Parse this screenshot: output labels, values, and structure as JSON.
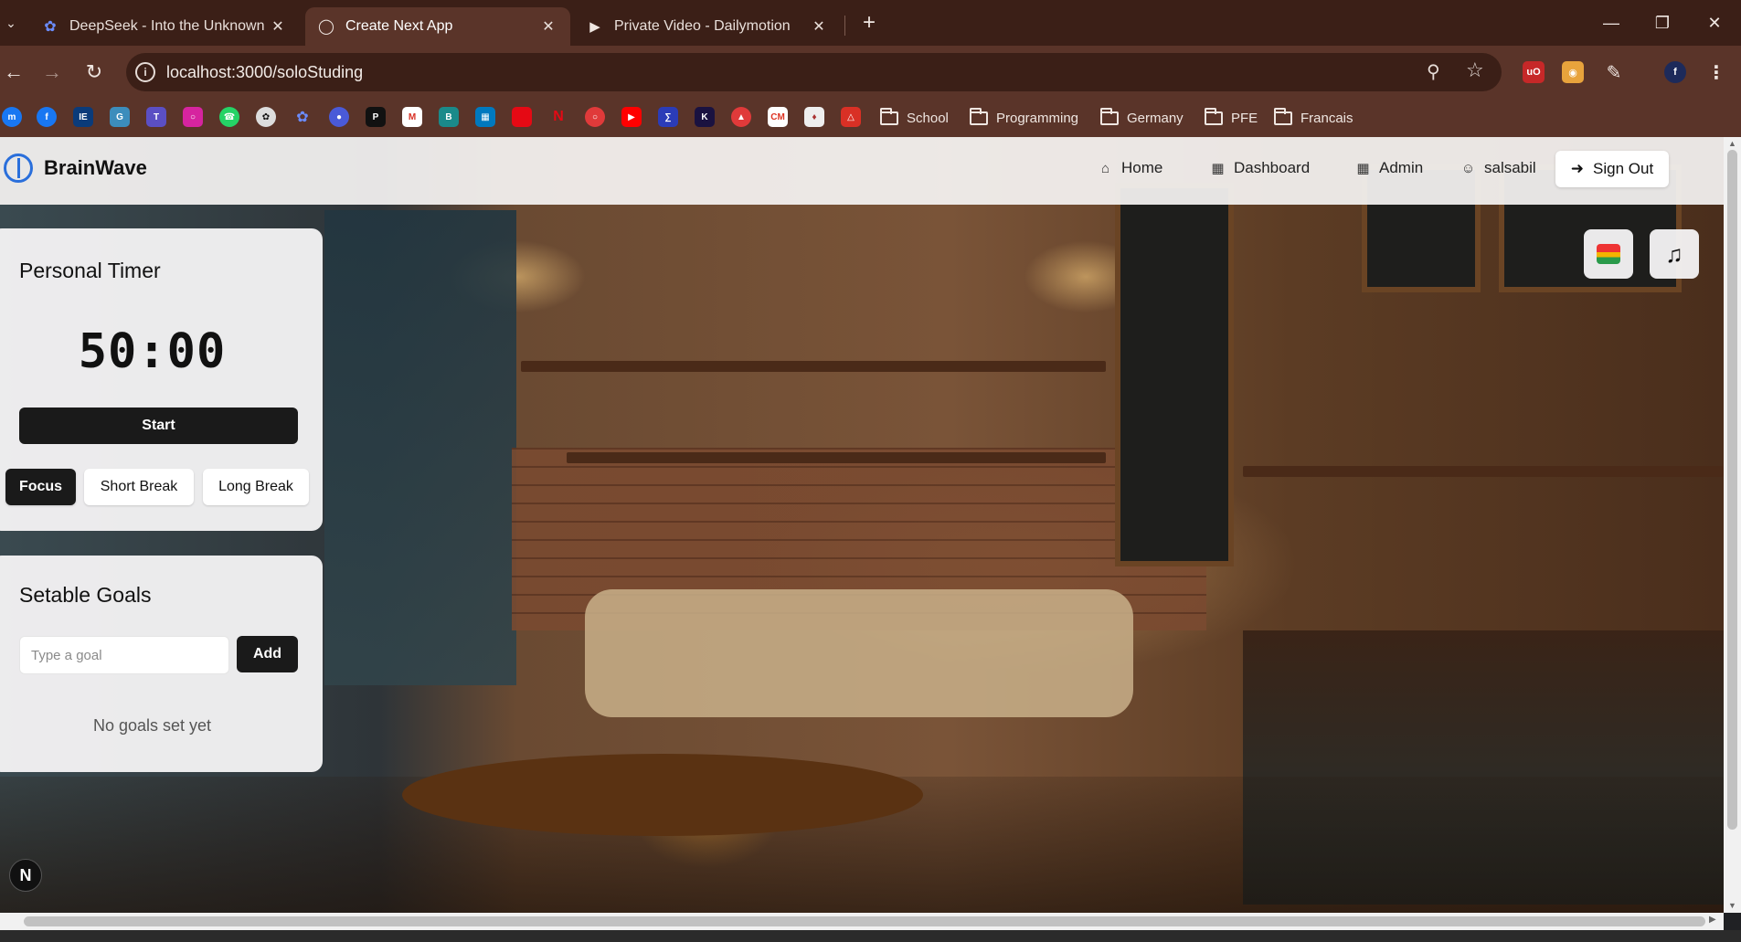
{
  "browser": {
    "tabs": [
      {
        "title": "DeepSeek - Into the Unknown",
        "icon": "deepseek-icon",
        "active": false
      },
      {
        "title": "Create Next App",
        "icon": "globe-icon",
        "active": true
      },
      {
        "title": "Private Video - Dailymotion",
        "icon": "dailymotion-icon",
        "active": false
      }
    ],
    "url": "localhost:3000/soloStuding",
    "bookmark_folders": [
      "School",
      "Programming",
      "Germany",
      "PFE",
      "Francais"
    ]
  },
  "app": {
    "brand": "BrainWave",
    "nav": {
      "home": "Home",
      "dashboard": "Dashboard",
      "admin": "Admin",
      "user": "salsabil",
      "sign_out": "Sign Out"
    },
    "timer": {
      "title": "Personal Timer",
      "display": "50:00",
      "start_label": "Start",
      "modes": [
        "Focus",
        "Short Break",
        "Long Break"
      ],
      "active_mode": "Focus"
    },
    "goals": {
      "title": "Setable Goals",
      "input_placeholder": "Type a goal",
      "add_label": "Add",
      "empty_message": "No goals set yet"
    },
    "next_badge": "N"
  },
  "colors": {
    "browser_frame": "#3b1f17",
    "toolbar": "#5a3429",
    "primary_button": "#1a1a1a",
    "brand_accent": "#2a6fdb"
  }
}
